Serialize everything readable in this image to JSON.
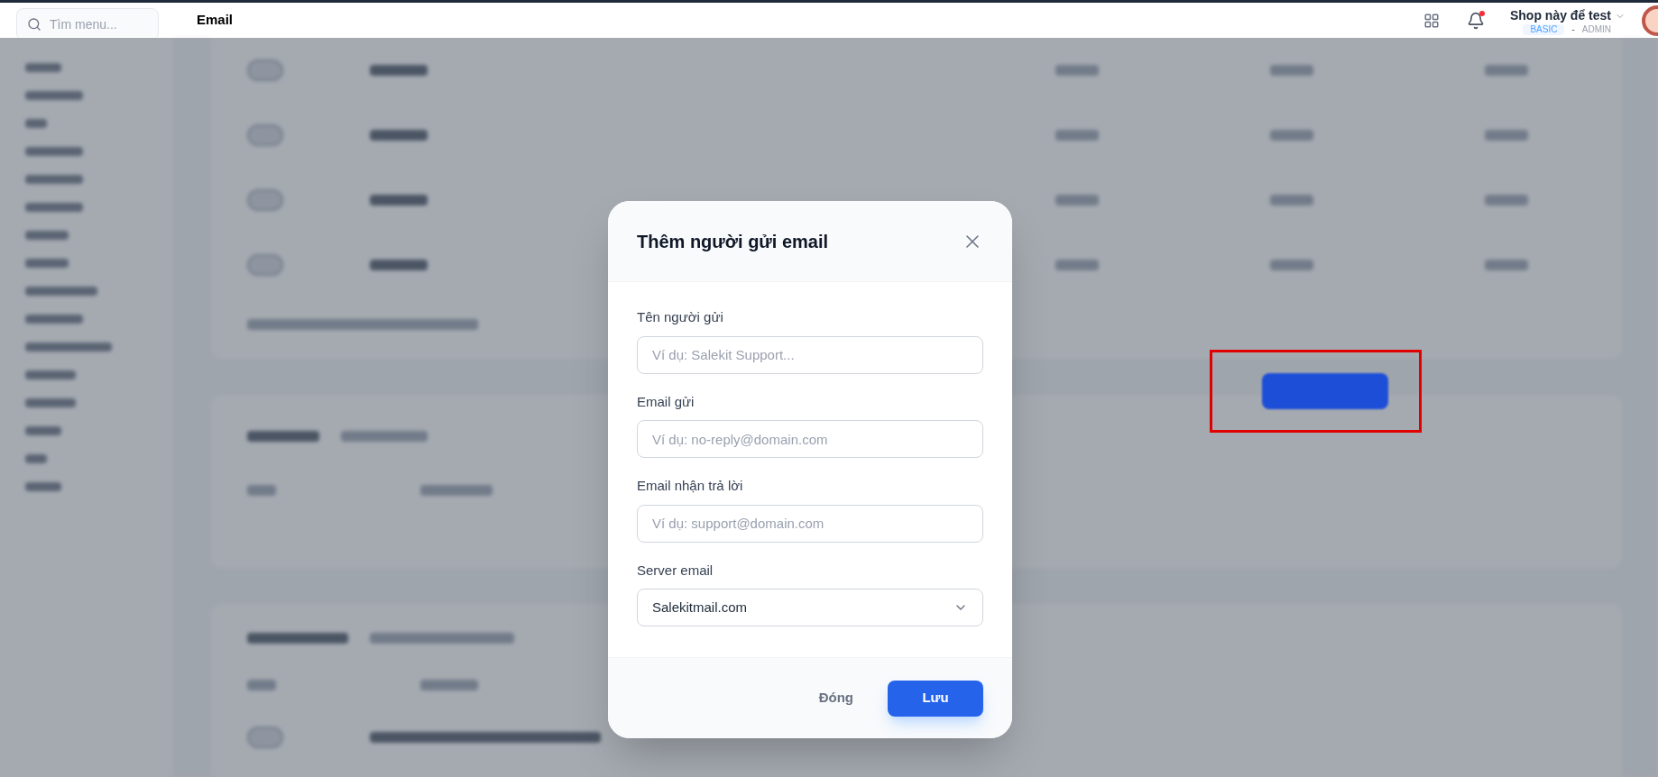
{
  "search": {
    "placeholder": "Tìm menu..."
  },
  "page_title": "Email",
  "background_toggles": [
    {
      "on": false
    },
    {
      "on": false
    },
    {
      "on": false
    },
    {
      "on": false
    },
    {
      "on": false
    }
  ],
  "header": {
    "shop_name": "Shop này để test",
    "plan": "BASIC",
    "separator": "-",
    "role": "ADMIN",
    "notification_dot": true
  },
  "modal": {
    "title": "Thêm người gửi email",
    "fields": [
      {
        "kind": "text",
        "label": "Tên người gửi",
        "placeholder": "Ví dụ: Salekit Support..."
      },
      {
        "kind": "text",
        "label": "Email gửi",
        "placeholder": "Ví dụ: no-reply@domain.com"
      },
      {
        "kind": "text",
        "label": "Email nhận trả lời",
        "placeholder": "Ví dụ: support@domain.com"
      },
      {
        "kind": "select",
        "label": "Server email",
        "value": "Salekitmail.com"
      }
    ],
    "buttons": [
      {
        "kind": "secondary",
        "label": "Đóng"
      },
      {
        "kind": "primary",
        "label": "Lưu"
      }
    ]
  }
}
